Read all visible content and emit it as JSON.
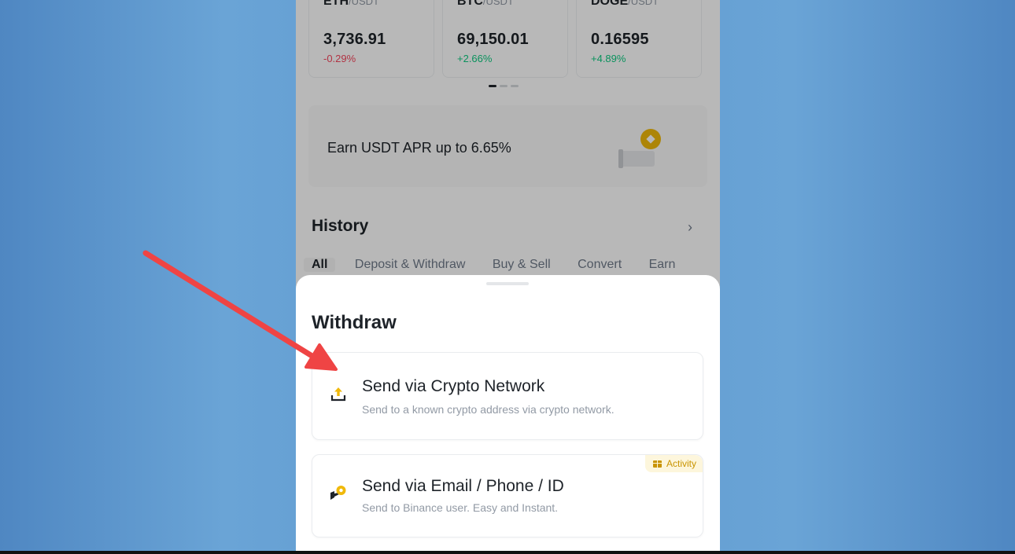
{
  "tickers": [
    {
      "base": "ETH",
      "quote": "/USDT",
      "price": "3,736.91",
      "change": "-0.29%",
      "direction": "down"
    },
    {
      "base": "BTC",
      "quote": "/USDT",
      "price": "69,150.01",
      "change": "+2.66%",
      "direction": "up"
    },
    {
      "base": "DOGE",
      "quote": "/USDT",
      "price": "0.16595",
      "change": "+4.89%",
      "direction": "up"
    }
  ],
  "earn_banner": {
    "text": "Earn USDT APR up to 6.65%"
  },
  "history": {
    "title": "History",
    "tabs": [
      "All",
      "Deposit & Withdraw",
      "Buy & Sell",
      "Convert",
      "Earn"
    ],
    "active_tab": "All"
  },
  "withdraw_sheet": {
    "title": "Withdraw",
    "options": [
      {
        "title": "Send via Crypto Network",
        "description": "Send to a known crypto address via crypto network.",
        "icon": "upload-tray-icon"
      },
      {
        "title": "Send via Email / Phone / ID",
        "description": "Send to Binance user. Easy and Instant.",
        "icon": "send-coin-icon",
        "badge": "Activity"
      }
    ]
  },
  "colors": {
    "accent": "#f0b90b",
    "negative": "#f6465d",
    "positive": "#0ecb81",
    "annotation_arrow": "#ef4444",
    "background": "#5d98cf"
  }
}
